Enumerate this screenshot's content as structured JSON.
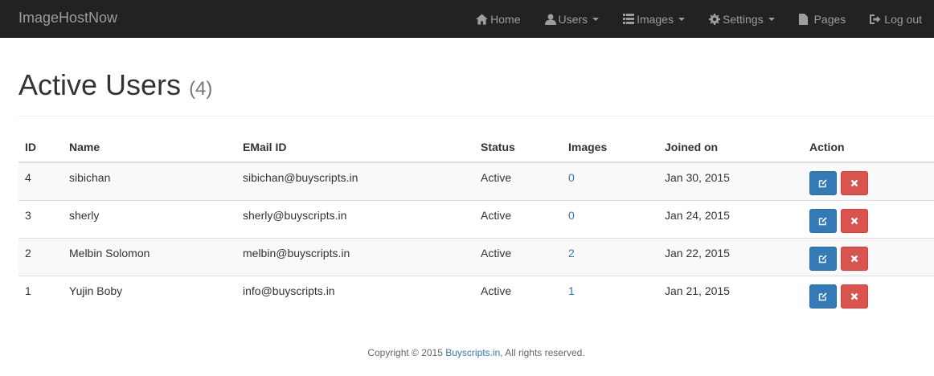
{
  "navbar": {
    "brand": "ImageHostNow",
    "items": [
      {
        "label": "Home",
        "icon": "home-icon"
      },
      {
        "label": "Users",
        "icon": "user-icon",
        "dropdown": true
      },
      {
        "label": "Images",
        "icon": "list-icon",
        "dropdown": true
      },
      {
        "label": "Settings",
        "icon": "gear-icon",
        "dropdown": true
      },
      {
        "label": "Pages",
        "icon": "file-icon"
      },
      {
        "label": "Log out",
        "icon": "logout-icon"
      }
    ]
  },
  "header": {
    "title": "Active Users",
    "count": "(4)"
  },
  "table": {
    "columns": [
      "ID",
      "Name",
      "EMail ID",
      "Status",
      "Images",
      "Joined on",
      "Action"
    ],
    "rows": [
      {
        "id": "4",
        "name": "sibichan",
        "email": "sibichan@buyscripts.in",
        "status": "Active",
        "images": "0",
        "joined": "Jan 30, 2015"
      },
      {
        "id": "3",
        "name": "sherly",
        "email": "sherly@buyscripts.in",
        "status": "Active",
        "images": "0",
        "joined": "Jan 24, 2015"
      },
      {
        "id": "2",
        "name": "Melbin Solomon",
        "email": "melbin@buyscripts.in",
        "status": "Active",
        "images": "2",
        "joined": "Jan 22, 2015"
      },
      {
        "id": "1",
        "name": "Yujin Boby",
        "email": "info@buyscripts.in",
        "status": "Active",
        "images": "1",
        "joined": "Jan 21, 2015"
      }
    ]
  },
  "footer": {
    "prefix": "Copyright © 2015 ",
    "link": "Buyscripts.in",
    "suffix": ", All rights reserved."
  },
  "colors": {
    "navbar_bg": "#222222",
    "nav_text": "#9d9d9d",
    "primary": "#337ab7",
    "danger": "#d9534f"
  }
}
